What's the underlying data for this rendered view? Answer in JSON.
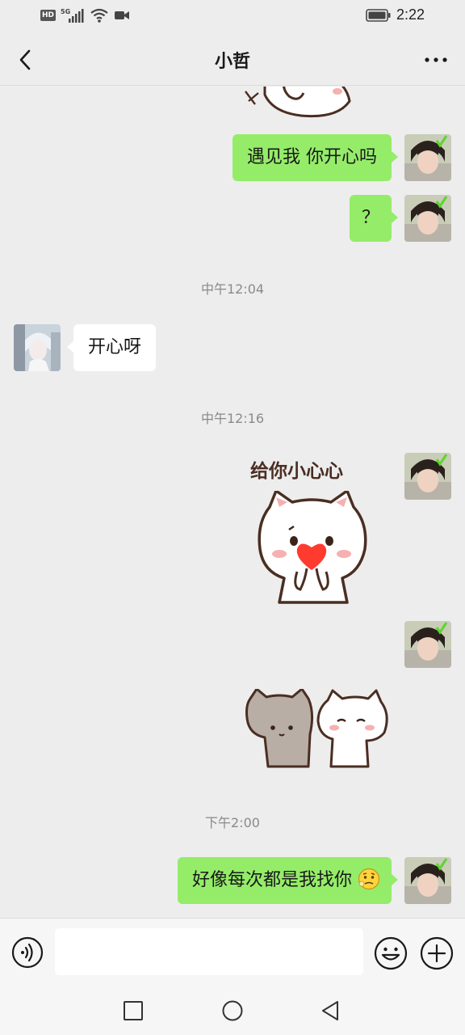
{
  "status_bar": {
    "network_badge": "HD",
    "signal_label": "5G",
    "time": "2:22"
  },
  "nav": {
    "title": "小哲",
    "back_icon": "chevron-left-icon",
    "more_icon": "more-dots-icon"
  },
  "messages": [
    {
      "id": "m1",
      "from": "me",
      "type": "text",
      "text": "遇见我 你开心吗"
    },
    {
      "id": "m2",
      "from": "me",
      "type": "text",
      "text": "？"
    },
    {
      "id": "t1",
      "type": "time",
      "text": "中午12:04"
    },
    {
      "id": "m3",
      "from": "other",
      "type": "text",
      "text": "开心呀"
    },
    {
      "id": "t2",
      "type": "time",
      "text": "中午12:16"
    },
    {
      "id": "m4",
      "from": "me",
      "type": "sticker",
      "caption": "给你小心心",
      "sticker": "white-cat-holding-heart"
    },
    {
      "id": "m5",
      "from": "me",
      "type": "sticker",
      "sticker": "grey-and-white-cats"
    },
    {
      "id": "t3",
      "type": "time",
      "text": "下午2:00"
    },
    {
      "id": "m6",
      "from": "me",
      "type": "text",
      "text": "好像每次都是我找你",
      "emoji": "thinking-face"
    }
  ],
  "input": {
    "value": "",
    "voice_icon": "voice-icon",
    "emoji_icon": "smile-icon",
    "plus_icon": "plus-icon"
  },
  "system_nav": {
    "recent": "square-icon",
    "home": "circle-icon",
    "back": "triangle-back-icon"
  },
  "colors": {
    "background": "#ededed",
    "my_bubble": "#95ec69",
    "other_bubble": "#ffffff",
    "timestamp": "#8a8a8a"
  }
}
